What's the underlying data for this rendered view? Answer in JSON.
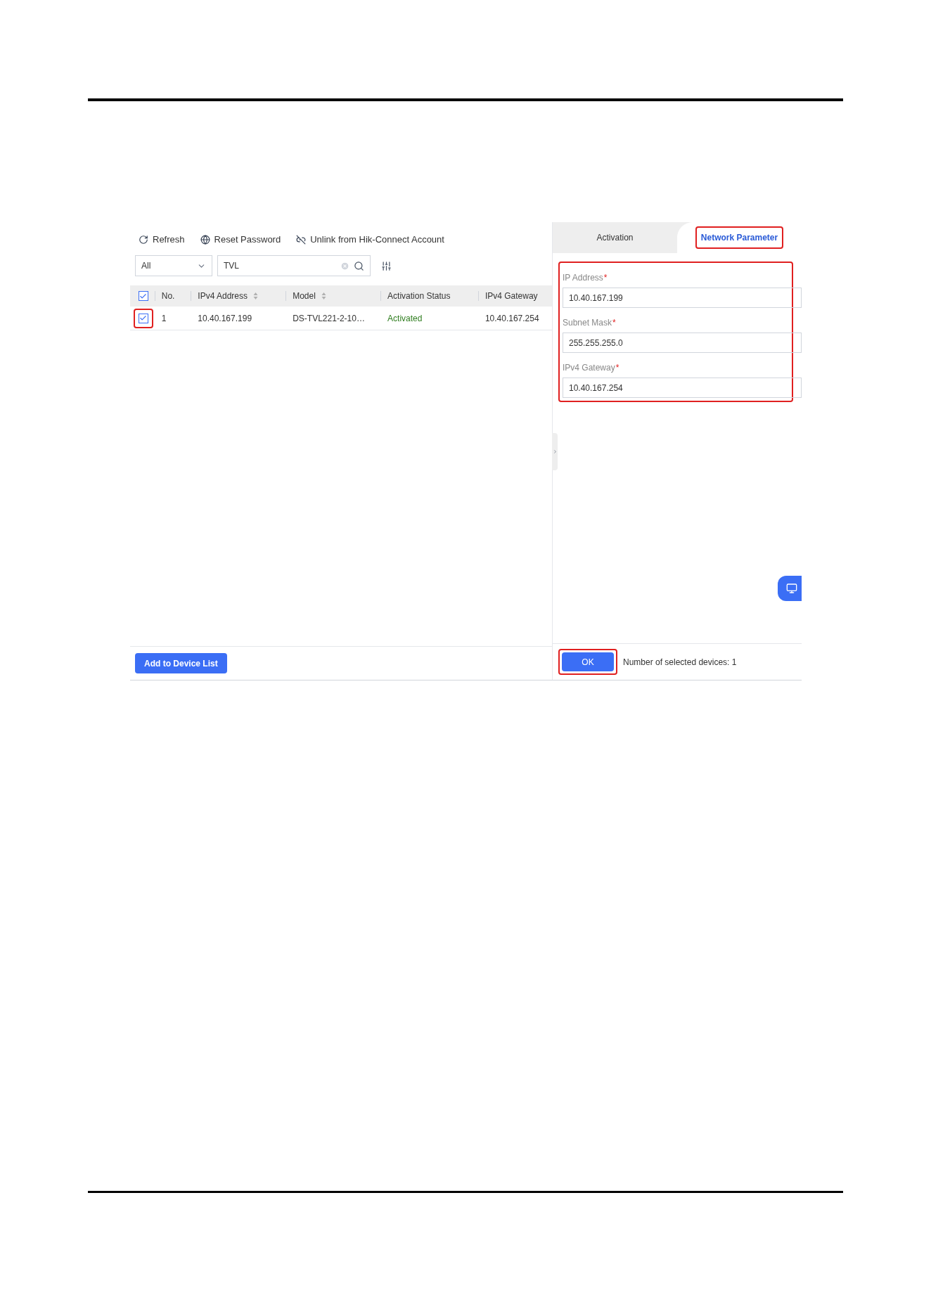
{
  "toolbar": [
    {
      "kind": "refresh",
      "label": "Refresh"
    },
    {
      "kind": "reset",
      "label": "Reset Password"
    },
    {
      "kind": "unlink",
      "label": "Unlink from Hik-Connect Account"
    }
  ],
  "filter": {
    "value": "All"
  },
  "search": {
    "value": "TVL"
  },
  "table": {
    "header_checked": true,
    "columns": [
      {
        "label": "No.",
        "sortable": false
      },
      {
        "label": "IPv4 Address",
        "sortable": true
      },
      {
        "label": "Model",
        "sortable": true
      },
      {
        "label": "Activation Status",
        "sortable": false
      },
      {
        "label": "IPv4 Gateway",
        "sortable": false
      }
    ],
    "rows": [
      {
        "checked": true,
        "highlighted": true,
        "color": "#2f7d1f",
        "cells": [
          "1",
          "10.40.167.199",
          "DS-TVL221-2-10…",
          "Activated",
          "10.40.167.254"
        ]
      }
    ]
  },
  "add_button": "Add to Device List",
  "tabs": [
    {
      "label": "Activation",
      "selected": false,
      "highlighted": false
    },
    {
      "label": "Network Parameter",
      "selected": true,
      "highlighted": true
    }
  ],
  "form": {
    "highlighted": true,
    "fields": [
      {
        "label": "IP Address",
        "required_mark": "*",
        "value": "10.40.167.199"
      },
      {
        "label": "Subnet Mask",
        "required_mark": "*",
        "value": "255.255.255.0"
      },
      {
        "label": "IPv4 Gateway",
        "required_mark": "*",
        "value": "10.40.167.254"
      }
    ]
  },
  "ok_button": {
    "label": "OK",
    "highlighted": true
  },
  "selected_count": "Number of selected devices: 1"
}
